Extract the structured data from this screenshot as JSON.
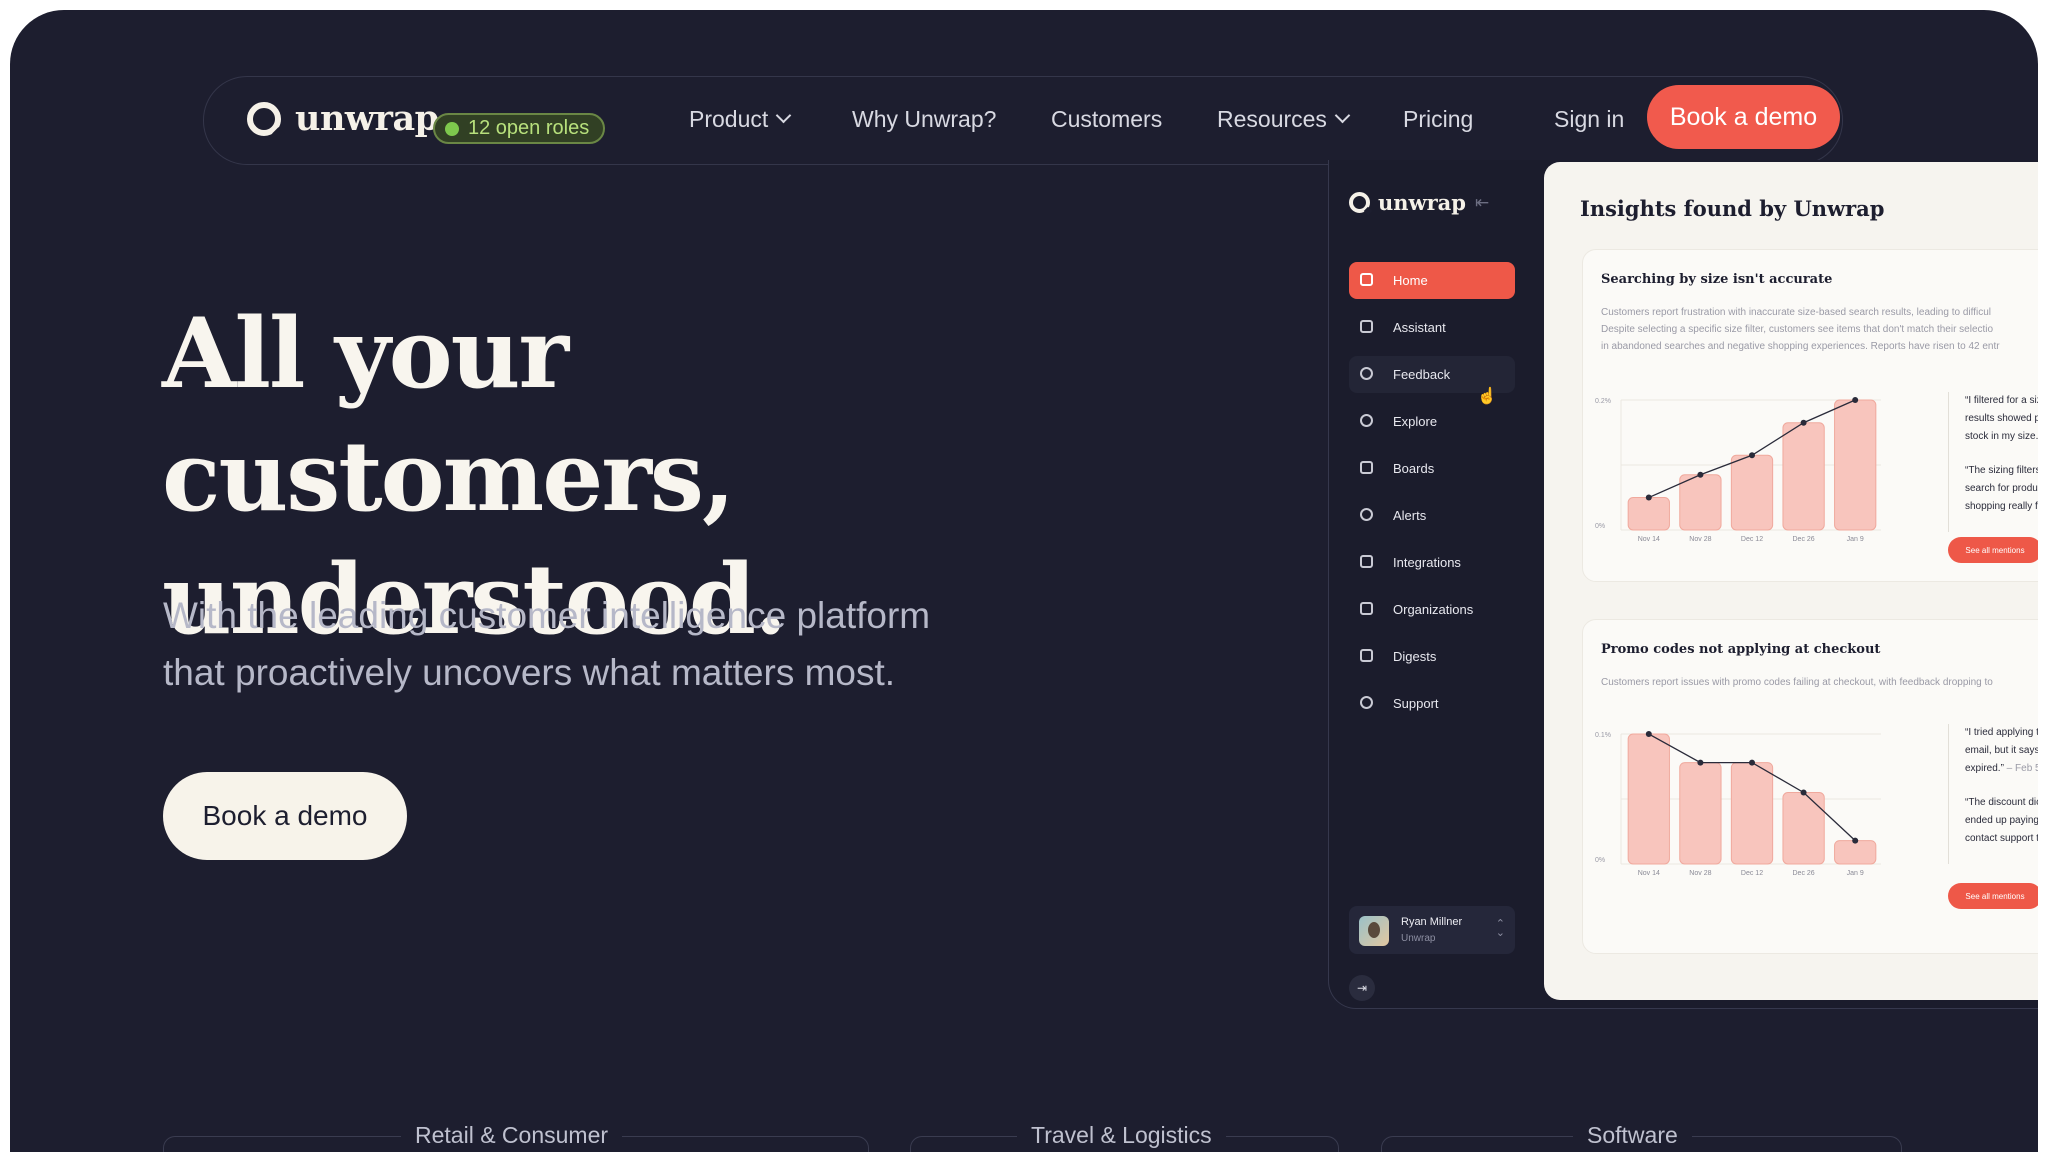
{
  "nav": {
    "logo": "unwrap",
    "roles_badge": "12 open roles",
    "items": [
      "Product",
      "Why Unwrap?",
      "Customers",
      "Resources",
      "Pricing"
    ],
    "sign_in": "Sign in",
    "cta": "Book a demo"
  },
  "hero": {
    "title_line1": "All your customers,",
    "title_line2": "understood.",
    "subtitle_line1": "With the leading customer intelligence platform",
    "subtitle_line2": "that proactively uncovers what matters most.",
    "cta": "Book a demo"
  },
  "app": {
    "logo": "unwrap",
    "sidebar": [
      "Home",
      "Assistant",
      "Feedback",
      "Explore",
      "Boards",
      "Alerts",
      "Integrations",
      "Organizations",
      "Digests",
      "Support"
    ],
    "user": {
      "name": "Ryan Millner",
      "org": "Unwrap"
    },
    "panel_title": "Insights found by Unwrap",
    "cards": [
      {
        "title": "Searching by size isn't accurate",
        "desc_line1": "Customers report frustration with inaccurate size-based search results, leading to difficul",
        "desc_line2": "Despite selecting a specific size filter, customers see items that don't match their selectio",
        "desc_line3": "in abandoned searches and negative shopping experiences. Reports have risen to 42 entr",
        "chart_data": {
          "type": "bar",
          "categories": [
            "Nov 14",
            "Nov 28",
            "Dec 12",
            "Dec 26",
            "Jan 9"
          ],
          "y_tick_top": "0.2%",
          "y_tick_bottom": "0%",
          "values": [
            0.05,
            0.085,
            0.115,
            0.165,
            0.2
          ],
          "ylim": [
            0,
            0.2
          ]
        },
        "quotes": [
          {
            "l1": "“I filtered for a siz",
            "l2": "results showed p",
            "l3": "stock in my size.”"
          },
          {
            "l1": "“The sizing filters",
            "l2": "search for produ",
            "l3": "shopping really fr"
          }
        ],
        "see_all": "See all mentions"
      },
      {
        "title": "Promo codes not applying at checkout",
        "desc_line1": "Customers report issues with promo codes failing at checkout, with feedback dropping to",
        "chart_data": {
          "type": "bar",
          "categories": [
            "Nov 14",
            "Nov 28",
            "Dec 12",
            "Dec 26",
            "Jan 9"
          ],
          "y_tick_top": "0.1%",
          "y_tick_bottom": "0%",
          "values": [
            0.1,
            0.078,
            0.078,
            0.055,
            0.018
          ],
          "ylim": [
            0,
            0.1
          ]
        },
        "quotes": [
          {
            "l1": "“I tried applying t",
            "l2": "email, but it says",
            "l3": "expired.”",
            "date": " – Feb 5"
          },
          {
            "l1": "“The discount dic",
            "l2": "ended up paying",
            "l3": "contact support t"
          }
        ],
        "see_all": "See all mentions"
      }
    ]
  },
  "industries": [
    "Retail & Consumer",
    "Travel & Logistics",
    "Software"
  ]
}
